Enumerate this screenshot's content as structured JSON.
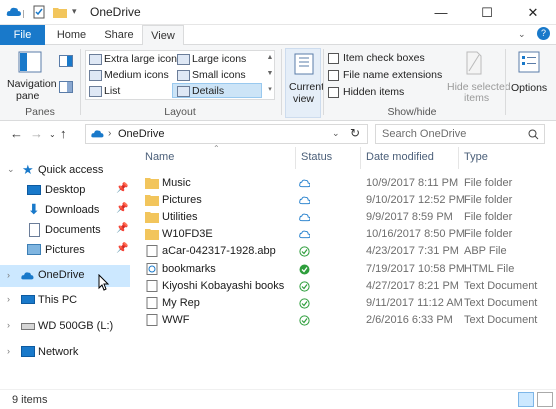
{
  "window": {
    "title": "OneDrive",
    "close": "✕",
    "minimize": "—",
    "maximize": "☐",
    "help": "?"
  },
  "tabs": {
    "file": "File",
    "home": "Home",
    "share": "Share",
    "view": "View"
  },
  "ribbon": {
    "panes": {
      "navigation_pane": "Navigation",
      "navigation_pane2": "pane",
      "group": "Panes"
    },
    "layout": {
      "extra_large": "Extra large icons",
      "large": "Large icons",
      "medium": "Medium icons",
      "small": "Small icons",
      "list": "List",
      "details": "Details",
      "group": "Layout"
    },
    "current_view": {
      "line1": "Current",
      "line2": "view"
    },
    "show_hide": {
      "item_checkboxes": "Item check boxes",
      "file_name_extensions": "File name extensions",
      "hidden_items": "Hidden items",
      "hide_selected_1": "Hide selected",
      "hide_selected_2": "items",
      "group": "Show/hide"
    },
    "options": "Options"
  },
  "address": {
    "path": "OneDrive",
    "search_placeholder": "Search OneDrive"
  },
  "nav": {
    "quick_access": "Quick access",
    "desktop": "Desktop",
    "downloads": "Downloads",
    "documents": "Documents",
    "pictures": "Pictures",
    "onedrive": "OneDrive",
    "this_pc": "This PC",
    "wd": "WD 500GB (L:)",
    "network": "Network"
  },
  "columns": {
    "name": "Name",
    "status": "Status",
    "date": "Date modified",
    "type": "Type"
  },
  "files": [
    {
      "name": "Music",
      "date": "10/9/2017 8:11 PM",
      "type": "File folder",
      "kind": "folder",
      "status": "cloud"
    },
    {
      "name": "Pictures",
      "date": "9/10/2017 12:52 PM",
      "type": "File folder",
      "kind": "folder",
      "status": "cloud"
    },
    {
      "name": "Utilities",
      "date": "9/9/2017 8:59 PM",
      "type": "File folder",
      "kind": "folder",
      "status": "cloud"
    },
    {
      "name": "W10FD3E",
      "date": "10/16/2017 8:50 PM",
      "type": "File folder",
      "kind": "folder",
      "status": "cloud"
    },
    {
      "name": "aCar-042317-1928.abp",
      "date": "4/23/2017 7:31 PM",
      "type": "ABP File",
      "kind": "file",
      "status": "check"
    },
    {
      "name": "bookmarks",
      "date": "7/19/2017 10:58 PM",
      "type": "HTML File",
      "kind": "html",
      "status": "check-filled"
    },
    {
      "name": "Kiyoshi Kobayashi books",
      "date": "4/27/2017 8:21 PM",
      "type": "Text Document",
      "kind": "file",
      "status": "check"
    },
    {
      "name": "My Rep",
      "date": "9/11/2017 11:12 AM",
      "type": "Text Document",
      "kind": "file",
      "status": "check"
    },
    {
      "name": "WWF",
      "date": "2/6/2016 6:33 PM",
      "type": "Text Document",
      "kind": "file",
      "status": "check"
    }
  ],
  "status_bar": {
    "count": "9 items"
  },
  "colors": {
    "accent": "#1979ca",
    "folder": "#f2c55c",
    "selection": "#cce8ff",
    "sync_green": "#2e9e3c"
  }
}
